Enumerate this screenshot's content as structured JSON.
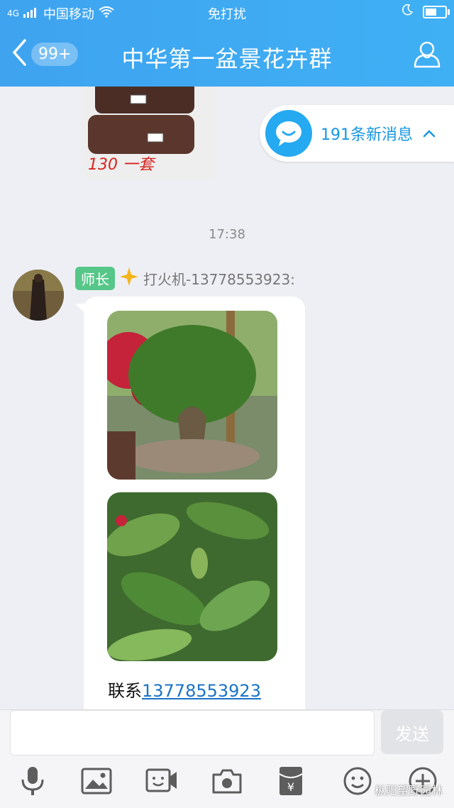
{
  "status_bar": {
    "carrier": "中国移动",
    "network": "4G",
    "center_text": "免打扰"
  },
  "nav": {
    "unread_count": "99+",
    "title": "中华第一盆景花卉群"
  },
  "previous_image": {
    "caption": "130 一套"
  },
  "new_messages": {
    "label": "191条新消息"
  },
  "timestamp": "17:38",
  "message": {
    "sender_tag": "师长",
    "sender_name": "打火机-13778553923:",
    "contact_prefix": "联系",
    "contact_phone": "13778553923"
  },
  "input": {
    "placeholder": "",
    "send_label": "发送"
  },
  "watermark": "枞阳望野园林",
  "colors": {
    "header": "#3fa8f2",
    "accent": "#1596e4",
    "tag": "#56c789"
  }
}
